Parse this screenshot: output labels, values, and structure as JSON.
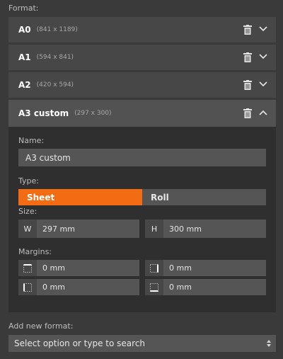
{
  "format_label": "Format:",
  "formats": [
    {
      "name": "A0",
      "dims": "(841 x 1189)"
    },
    {
      "name": "A1",
      "dims": "(594 x 841)"
    },
    {
      "name": "A2",
      "dims": "(420 x 594)"
    },
    {
      "name": "A3 custom",
      "dims": "(297 x 300)"
    }
  ],
  "editor": {
    "name_label": "Name:",
    "name_value": "A3 custom",
    "type_label": "Type:",
    "type_options": [
      "Sheet",
      "Roll"
    ],
    "type_selected": "Sheet",
    "size_label": "Size:",
    "width_tag": "W",
    "width_value": "297 mm",
    "height_tag": "H",
    "height_value": "300 mm",
    "margins_label": "Margins:",
    "margins": {
      "top": "0 mm",
      "right": "0 mm",
      "left": "0 mm",
      "bottom": "0 mm"
    }
  },
  "add_label": "Add new format:",
  "add_placeholder": "Select option or type to search",
  "colors": {
    "accent": "#f36c14",
    "background": "#3a3a3a",
    "row": "#474747",
    "panel": "#2f2f2f",
    "input": "#555555"
  }
}
